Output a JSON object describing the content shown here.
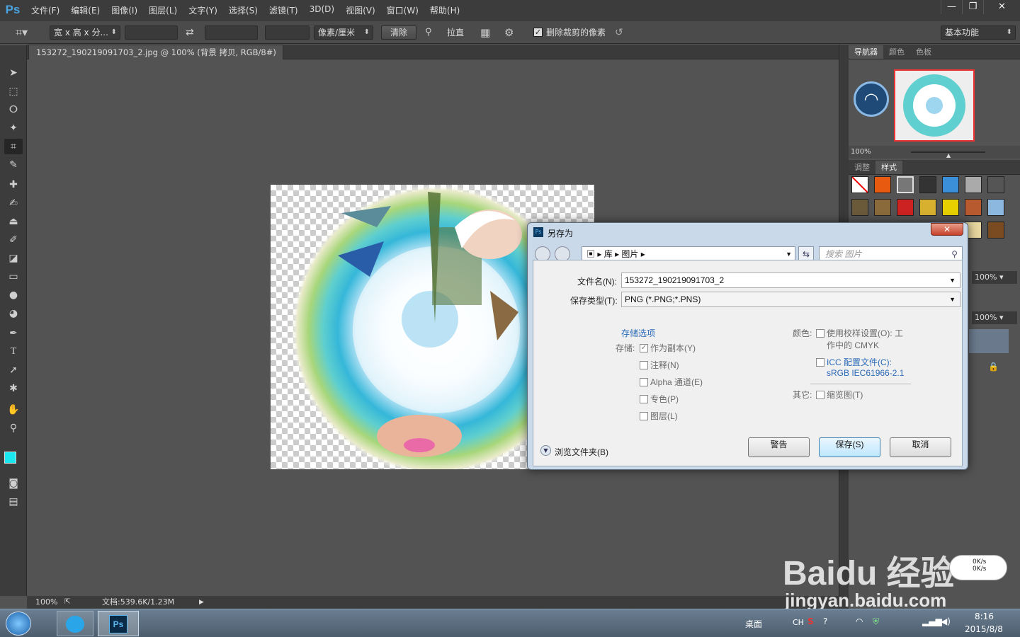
{
  "app": {
    "logo": "Ps"
  },
  "menu": [
    "文件(F)",
    "编辑(E)",
    "图像(I)",
    "图层(L)",
    "文字(Y)",
    "选择(S)",
    "滤镜(T)",
    "3D(D)",
    "视图(V)",
    "窗口(W)",
    "帮助(H)"
  ],
  "window_buttons": {
    "minimize": "—",
    "restore": "❐",
    "close": "✕"
  },
  "options": {
    "ratio_select": "宽 x 高 x 分...",
    "unit_select": "像素/厘米",
    "clear": "清除",
    "straighten": "拉直",
    "delete_cropped_label": "删除裁剪的像素",
    "delete_cropped_checked": true,
    "workspace": "基本功能"
  },
  "document": {
    "tab_title": "153272_190219091703_2.jpg @ 100% (背景 拷贝, RGB/8#) *",
    "tab_close": "×"
  },
  "status": {
    "zoom": "100%",
    "doc_info": "文档:539.6K/1.23M"
  },
  "panels": {
    "nav_tabs": [
      "导航器",
      "颜色",
      "色板"
    ],
    "nav_zoom": "100%",
    "adj_tabs": [
      "调整",
      "样式"
    ],
    "opacity1": "100%",
    "opacity2": "100%"
  },
  "dialog": {
    "title": "另存为",
    "close": "✕",
    "path": [
      "库",
      "图片"
    ],
    "search_placeholder": "搜索 图片",
    "filename_label": "文件名(N):",
    "filename": "153272_190219091703_2",
    "filetype_label": "保存类型(T):",
    "filetype": "PNG (*.PNG;*.PNS)",
    "save_options": "存储选项",
    "save_label": "存储:",
    "save_checks": [
      {
        "label": "作为副本(Y)",
        "checked": true
      },
      {
        "label": "注释(N)",
        "checked": false
      },
      {
        "label": "Alpha 通道(E)",
        "checked": false
      },
      {
        "label": "专色(P)",
        "checked": false
      },
      {
        "label": "图层(L)",
        "checked": false
      }
    ],
    "color_label": "颜色:",
    "proof_line1": "使用校样设置(O): 工",
    "proof_line2": "作中的 CMYK",
    "icc_line1": "ICC 配置文件(C):",
    "icc_line2": "sRGB IEC61966-2.1",
    "other_label": "其它:",
    "thumbnail": "缩览图(T)",
    "browse": "浏览文件夹(B)",
    "warn_btn": "警告",
    "save_btn": "保存(S)",
    "cancel_btn": "取消"
  },
  "taskbar": {
    "desktop": "桌面",
    "lang": "CH",
    "time": "8:16",
    "date": "2015/8/8",
    "net_up": "0K/s",
    "net_down": "0K/s"
  },
  "watermark": {
    "line1": "Baidu 经验",
    "line2": "jingyan.baidu.com"
  }
}
